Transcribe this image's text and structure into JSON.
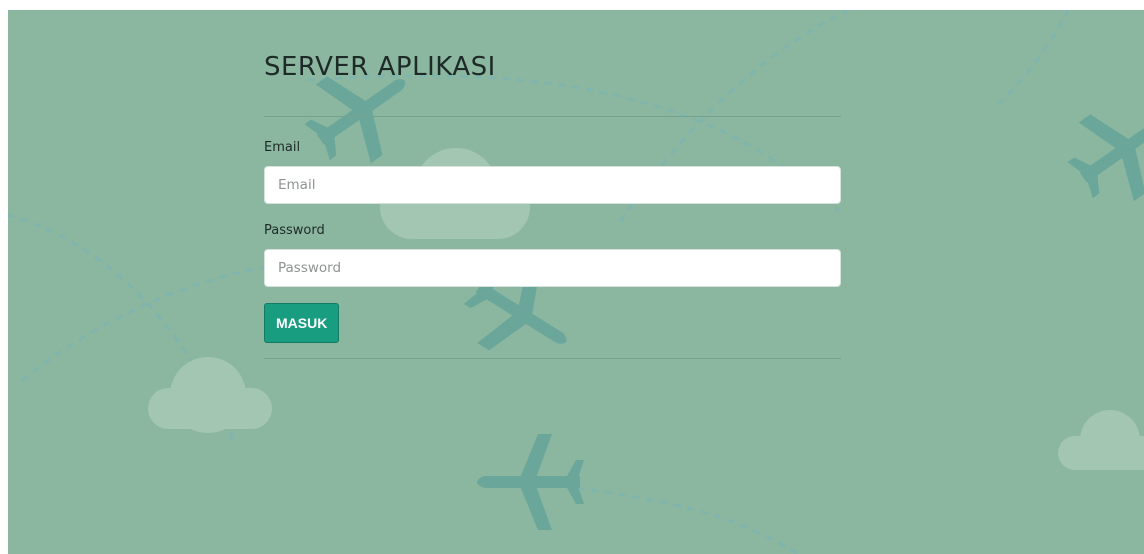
{
  "page": {
    "title": "SERVER APLIKASI",
    "background_color": "#8bb7a0",
    "cloud_color": "#a3c6b3",
    "plane_color": "#6aa69a",
    "accent_color": "#189d81"
  },
  "form": {
    "email": {
      "label": "Email",
      "placeholder": "Email",
      "value": ""
    },
    "password": {
      "label": "Password",
      "placeholder": "Password",
      "value": ""
    },
    "submit_label": "MASUK"
  },
  "decorations": {
    "icons": [
      "airplane-icon",
      "cloud-icon"
    ]
  }
}
